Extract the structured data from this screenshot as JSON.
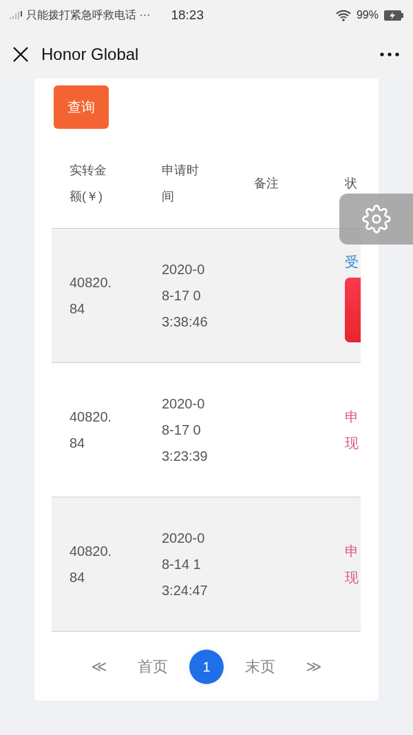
{
  "status_bar": {
    "carrier": "只能拨打紧急呼救电话 ···",
    "time": "18:23",
    "battery": "99%"
  },
  "header": {
    "title": "Honor Global"
  },
  "query_button": "查询",
  "table": {
    "columns": [
      "实转金额(￥)",
      "申请时间",
      "备注",
      "状"
    ],
    "rows": [
      {
        "amount": "40820.84",
        "time": "2020-08-17 03:38:46",
        "note": "",
        "status": {
          "kind": "accepted",
          "text": "受"
        }
      },
      {
        "amount": "40820.84",
        "time": "2020-08-17 03:23:39",
        "note": "",
        "status": {
          "kind": "pending",
          "text": "申现"
        }
      },
      {
        "amount": "40820.84",
        "time": "2020-08-14 13:24:47",
        "note": "",
        "status": {
          "kind": "pending",
          "text": "申现"
        }
      }
    ]
  },
  "pagination": {
    "prev": "≪",
    "first": "首页",
    "pages": [
      {
        "label": "1",
        "selected": true
      }
    ],
    "last": "末页",
    "next": "≫"
  }
}
